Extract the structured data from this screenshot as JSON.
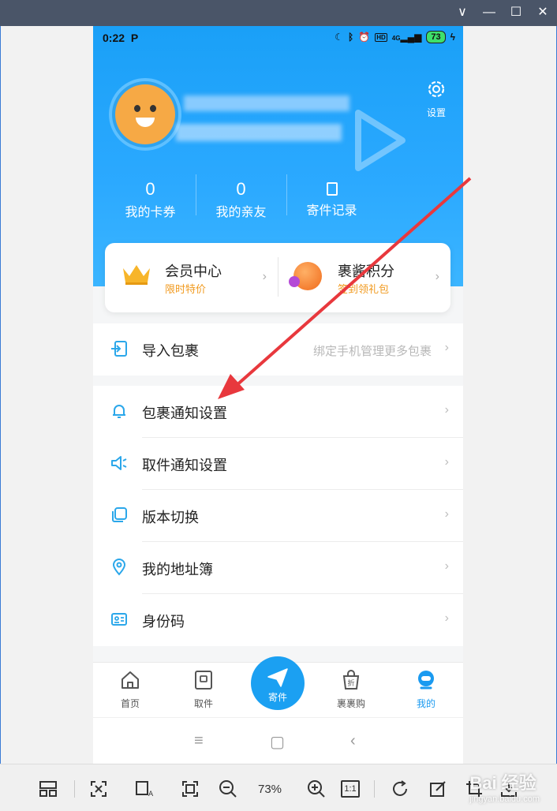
{
  "viewer": {
    "window_controls": [
      "∨",
      "—",
      "☐",
      "✕"
    ],
    "zoom": "73%",
    "actual_size": "1:1",
    "watermark": "Bai 经验",
    "watermark_sub": "jingyan.baidu.com"
  },
  "status_bar": {
    "time": "0:22",
    "app_mark": "P",
    "net": "4G",
    "battery": "73"
  },
  "header": {
    "settings_label": "设置"
  },
  "stats": [
    {
      "value": "0",
      "label": "我的卡券"
    },
    {
      "value": "0",
      "label": "我的亲友"
    },
    {
      "value": "",
      "label": "寄件记录"
    }
  ],
  "vip": [
    {
      "title": "会员中心",
      "subtitle": "限时特价"
    },
    {
      "title": "裹酱积分",
      "subtitle": "签到领礼包"
    }
  ],
  "import_row": {
    "label": "导入包裹",
    "hint": "绑定手机管理更多包裹"
  },
  "menu": [
    {
      "label": "包裹通知设置",
      "icon": "bell-icon"
    },
    {
      "label": "取件通知设置",
      "icon": "speaker-icon"
    },
    {
      "label": "版本切换",
      "icon": "copy-icon"
    },
    {
      "label": "我的地址簿",
      "icon": "location-icon"
    },
    {
      "label": "身份码",
      "icon": "id-card-icon"
    }
  ],
  "tabs": [
    {
      "label": "首页",
      "icon": "home-icon"
    },
    {
      "label": "取件",
      "icon": "pickup-icon"
    },
    {
      "label": "寄件",
      "icon": "send-icon"
    },
    {
      "label": "裹裹购",
      "icon": "shop-bag-icon"
    },
    {
      "label": "我的",
      "icon": "profile-icon"
    }
  ],
  "colors": {
    "brand_blue": "#1aa0f7",
    "accent_orange": "#f19a1f",
    "annotation_red": "#e8383d"
  }
}
